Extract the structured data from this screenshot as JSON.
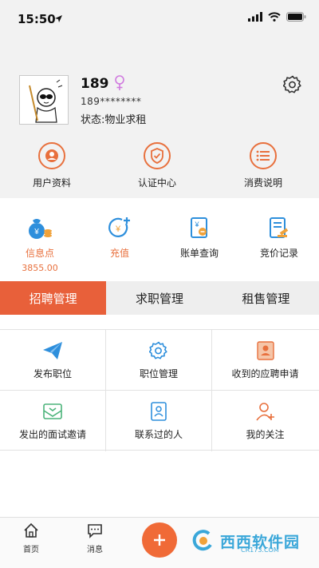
{
  "status_bar": {
    "time": "15:50"
  },
  "profile": {
    "username": "189",
    "phone": "189********",
    "state": "状态:物业求租"
  },
  "quick_links": [
    {
      "label": "用户资料",
      "icon": "user-profile-icon"
    },
    {
      "label": "认证中心",
      "icon": "shield-check-icon"
    },
    {
      "label": "消费说明",
      "icon": "list-chat-icon"
    }
  ],
  "wallet": [
    {
      "label": "信息点",
      "value": "3855.00",
      "icon": "money-bag-icon"
    },
    {
      "label": "充值",
      "icon": "recharge-icon"
    },
    {
      "label": "账单查询",
      "icon": "bill-query-icon"
    },
    {
      "label": "竞价记录",
      "icon": "bid-record-icon"
    }
  ],
  "tabs": [
    {
      "label": "招聘管理",
      "active": true
    },
    {
      "label": "求职管理",
      "active": false
    },
    {
      "label": "租售管理",
      "active": false
    }
  ],
  "grid": [
    {
      "label": "发布职位",
      "icon": "paper-plane-icon"
    },
    {
      "label": "职位管理",
      "icon": "gear-icon"
    },
    {
      "label": "收到的应聘申请",
      "icon": "resume-icon"
    },
    {
      "label": "发出的面试邀请",
      "icon": "invitation-envelope-icon"
    },
    {
      "label": "联系过的人",
      "icon": "contact-book-icon"
    },
    {
      "label": "我的关注",
      "icon": "person-add-icon"
    }
  ],
  "bottom_nav": [
    {
      "label": "首页",
      "icon": "home-icon"
    },
    {
      "label": "消息",
      "icon": "message-icon"
    }
  ],
  "watermark": {
    "text": "西西软件园",
    "sub": "CR173.COM"
  },
  "colors": {
    "accent": "#e8603a",
    "accent_icon": "#e8703d",
    "blue_icon": "#2e8fdc",
    "gender": "#d07adf"
  }
}
